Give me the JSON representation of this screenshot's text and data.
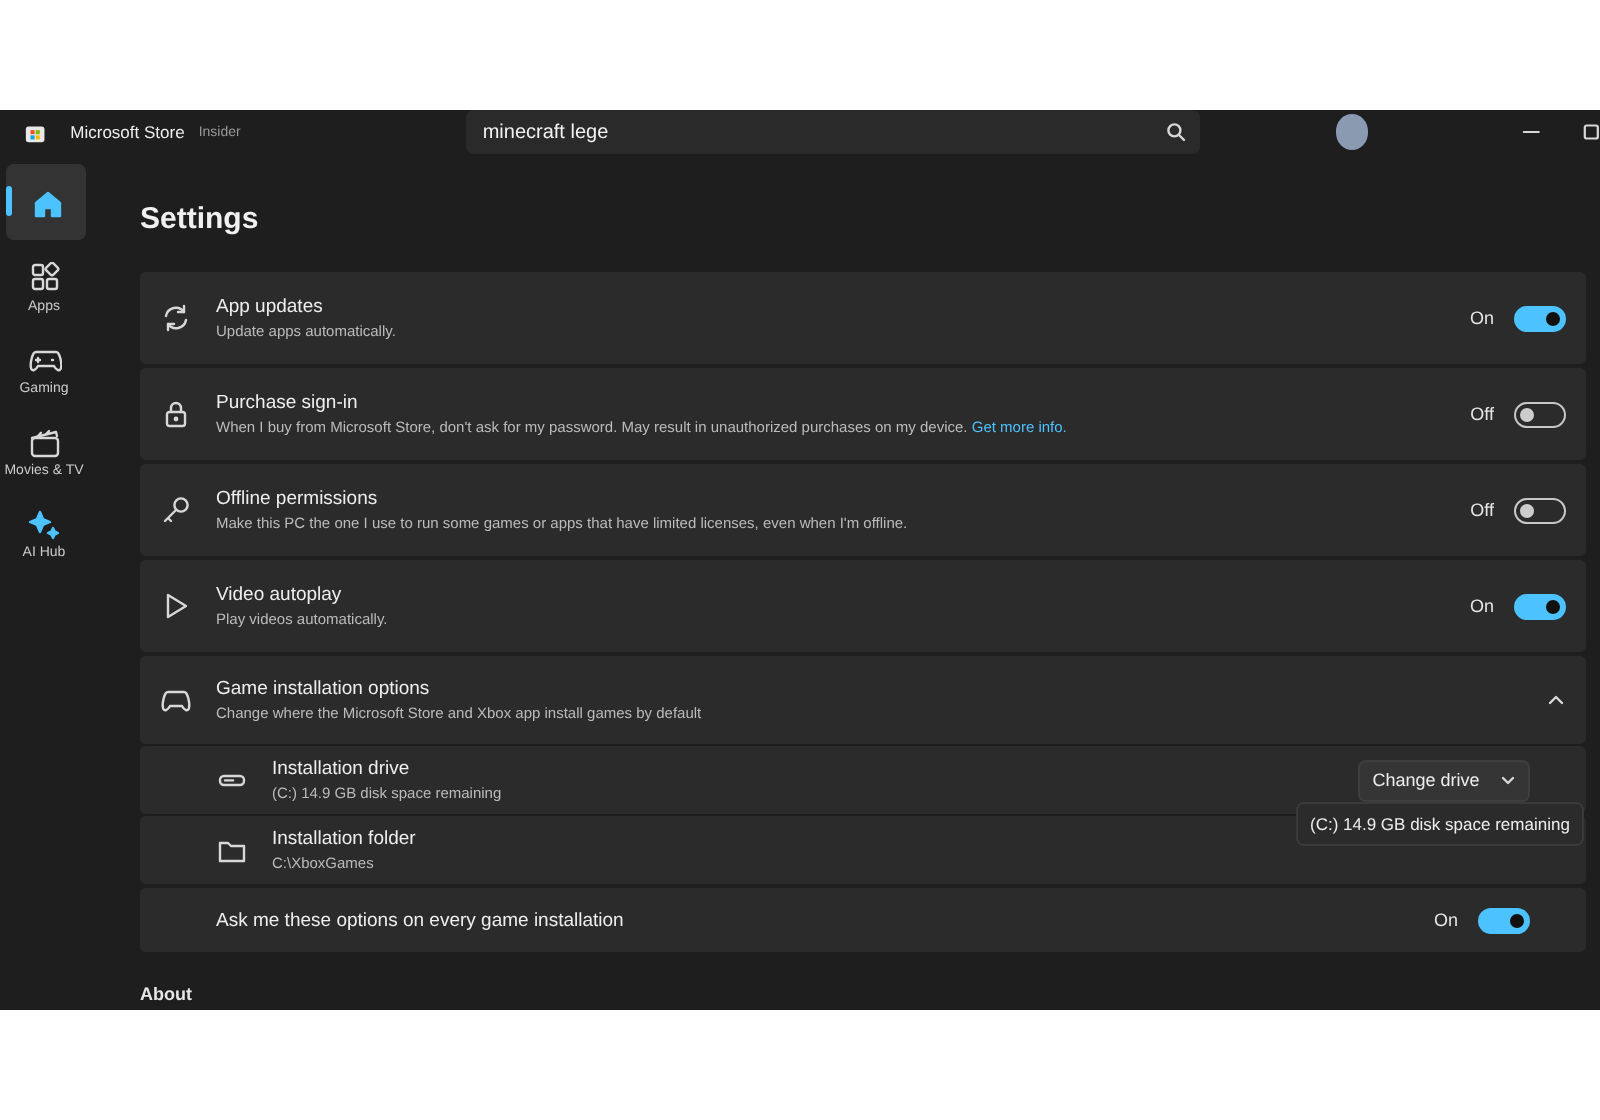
{
  "app": {
    "name": "Microsoft Store",
    "badge": "Insider"
  },
  "search": {
    "value": "minecraft lege"
  },
  "nav": [
    {
      "selected": true
    },
    {
      "label": "Apps",
      "selected": false
    },
    {
      "label": "Gaming",
      "selected": false
    },
    {
      "label": "Movies & TV",
      "selected": false
    },
    {
      "label": "AI Hub",
      "selected": false
    }
  ],
  "page_title": "Settings",
  "settings": [
    {
      "title": "App updates",
      "description": "Update apps automatically.",
      "on": true,
      "state_label": "On"
    },
    {
      "title": "Purchase sign-in",
      "description": "When I buy from Microsoft Store, don't ask for my password. May result in unauthorized purchases on my device.",
      "link": "Get more info.",
      "on": false,
      "state_label": "Off"
    },
    {
      "title": "Offline permissions",
      "description": "Make this PC the one I use to run some games or apps that have limited licenses, even when I'm offline.",
      "on": false,
      "state_label": "Off"
    },
    {
      "title": "Video autoplay",
      "description": "Play videos automatically.",
      "on": true,
      "state_label": "On"
    }
  ],
  "game_installation": {
    "title": "Game installation options",
    "description": "Change where the Microsoft Store and Xbox app install games by default",
    "expanded": true,
    "items": [
      {
        "kind": "drive",
        "title": "Installation drive",
        "description": "(C:) 14.9 GB disk space remaining",
        "button": "Change drive"
      },
      {
        "kind": "folder",
        "title": "Installation folder",
        "description": "C:\\XboxGames"
      }
    ],
    "ask": {
      "label": "Ask me these options on every game installation",
      "on": true,
      "state_label": "On"
    }
  },
  "tooltip": "(C:) 14.9 GB disk space remaining",
  "next_section": "About"
}
